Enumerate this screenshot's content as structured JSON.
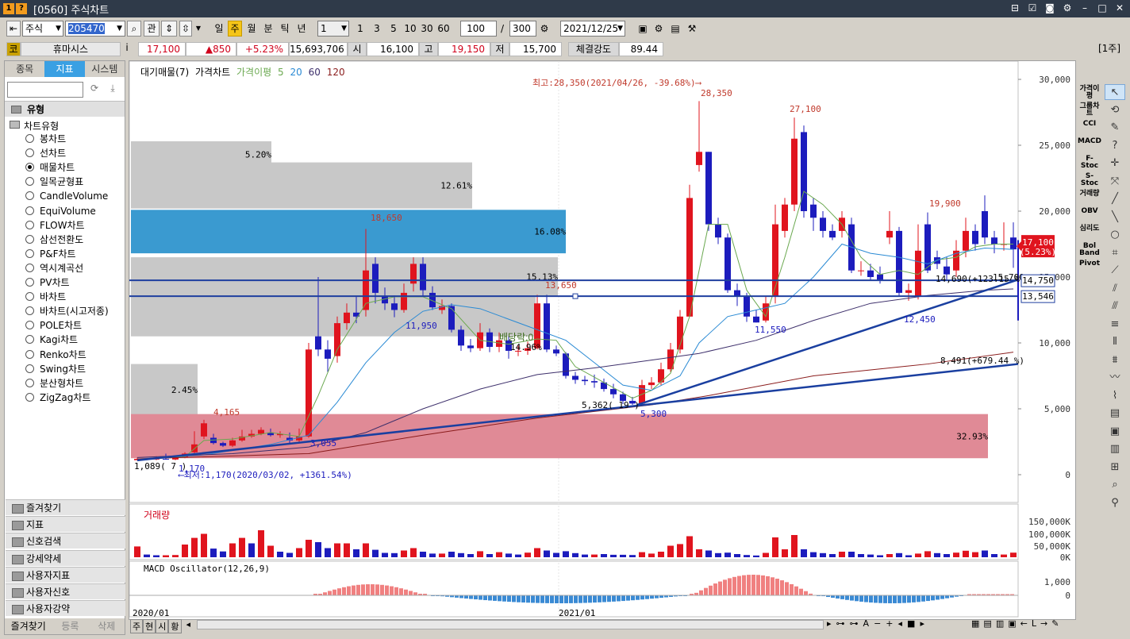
{
  "window": {
    "title": "[0560] 주식차트",
    "icon1": "1",
    "icon2": "?"
  },
  "toolbar": {
    "market": "주식",
    "code": "205470",
    "btn_gwan": "관",
    "periods": [
      "일",
      "주",
      "월",
      "분",
      "틱",
      "년"
    ],
    "unit_value": "1",
    "intervals": [
      "1",
      "3",
      "5",
      "10",
      "30",
      "60"
    ],
    "count": "100",
    "slash": "/",
    "total": "300",
    "date": "2021/12/25"
  },
  "quote": {
    "market_tag": "코",
    "name": "휴마시스",
    "price": "17,100",
    "change": "▲850",
    "change_pct": "+5.23%",
    "volume": "15,693,706",
    "open_label": "시",
    "open": "16,100",
    "high_label": "고",
    "high": "19,150",
    "low_label": "저",
    "low": "15,700",
    "strength_label": "체결강도",
    "strength": "89.44",
    "info_icon": "i",
    "week_badge": "[1주]"
  },
  "left_panel": {
    "tabs": [
      "종목",
      "지표",
      "시스템"
    ],
    "active_tab": "지표",
    "type_header": "유형",
    "chart_type_header": "차트유형",
    "chart_types": [
      "봉차트",
      "선차트",
      "매물차트",
      "일목균형표",
      "CandleVolume",
      "EquiVolume",
      "FLOW차트",
      "삼선전환도",
      "P&F차트",
      "역시계곡선",
      "PV차트",
      "바차트",
      "바차트(시고저종)",
      "POLE차트",
      "Kagi차트",
      "Renko차트",
      "Swing차트",
      "분산형차트",
      "ZigZag차트"
    ],
    "selected_type": "매물차트",
    "folders": [
      "즐겨찾기",
      "지표",
      "신호검색",
      "강세약세",
      "사용자지표",
      "사용자신호",
      "사용자강약"
    ],
    "bottom_buttons": [
      "즐겨찾기",
      "등록",
      "삭제"
    ]
  },
  "chart": {
    "legend": {
      "vp": "대기매물(7)",
      "price": "가격차트",
      "disparity": "가격이평",
      "ma": [
        "5",
        "20",
        "60",
        "120"
      ]
    },
    "colors": {
      "up": "#e0141e",
      "down": "#1c1cbd",
      "ma5": "#6aa84f",
      "ma20": "#2a8ad4",
      "ma60": "#3d2f6b",
      "ma120": "#8a1c1c",
      "trend": "#1a3fa0"
    },
    "y_ticks": [
      "30,000",
      "25,000",
      "20,000",
      "15,000",
      "10,000",
      "5,000",
      "0"
    ],
    "x_labels": [
      "2020/01",
      "2021/01"
    ],
    "annotations": {
      "high_note": "최고:28,350(2021/04/26, -39.68%)⟶",
      "low_note": "⟵최저:1,170(2020/03/02, +1361.54%)",
      "p28350": "28,350",
      "p27100": "27,100",
      "p19900": "19,900",
      "p18650": "18,650",
      "p13650": "13,650",
      "p11950": "11,950",
      "p11550": "11,550",
      "p12450": "12,450",
      "p4165": "4,165",
      "p3055": "3,055",
      "p5300": "5,300",
      "p5362": "5,362( 19 )",
      "p1089": "1,089(  7 )",
      "p1170": "1,170",
      "dividend": "배당락:0",
      "trend1": "14,690(+123.15 %)",
      "trend2": "8,491(+679.44 %)",
      "ma_cut": "15,700",
      "pct_hid": "14.96%"
    },
    "price_tags": {
      "last": "17,100",
      "last_pct": "(5.23%)",
      "line1": "14,750",
      "line2": "13,546"
    },
    "volume_profile": [
      {
        "pct": "5.20%",
        "color": "#c8c8c8"
      },
      {
        "pct": "12.61%",
        "color": "#c8c8c8"
      },
      {
        "pct": "16.08%",
        "color": "#3a9ad0"
      },
      {
        "pct": "15.13%",
        "color": "#c8c8c8"
      },
      {
        "pct": "",
        "color": "#c8c8c8"
      },
      {
        "pct": "2.45%",
        "color": "#c8c8c8"
      },
      {
        "pct": "32.93%",
        "color": "#e08a96"
      }
    ],
    "volume_title": "거래량",
    "volume_ticks": [
      "150,000K",
      "100,000K",
      "50,000K",
      "0K"
    ],
    "macd_title": "MACD Oscillator(12,26,9)",
    "macd_ticks": [
      "1,000",
      "0"
    ]
  },
  "right_tools": [
    "가격이평",
    "그룹차트",
    "CCI",
    "MACD",
    "F-Stoc",
    "S-Stoc",
    "거래량",
    "OBV",
    "심리도",
    "Bol Band",
    "Pivot"
  ],
  "bottom": {
    "left_btns": [
      "주",
      "현",
      "시",
      "황"
    ]
  }
}
